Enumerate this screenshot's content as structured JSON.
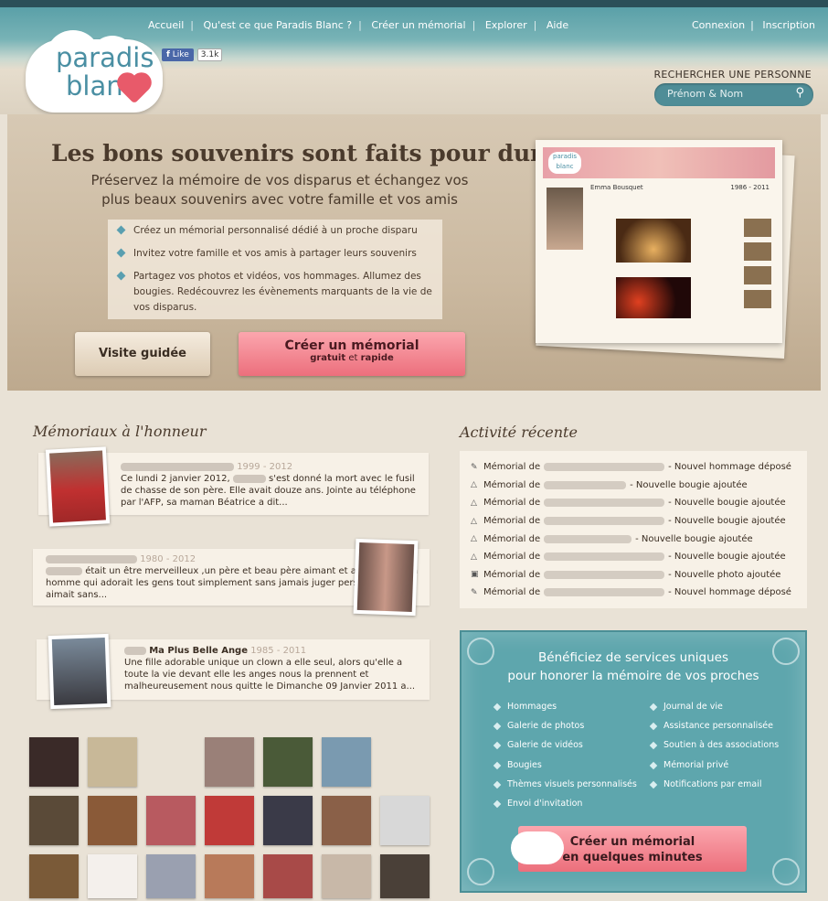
{
  "nav": {
    "items": [
      "Accueil",
      "Qu'est ce que Paradis Blanc ?",
      "Créer un mémorial",
      "Explorer",
      "Aide"
    ],
    "login": "Connexion",
    "signup": "Inscription"
  },
  "logo": {
    "line1": "paradis",
    "line2": "blanc"
  },
  "facebook": {
    "like": "Like",
    "count": "3.1k"
  },
  "search": {
    "label": "RECHERCHER UNE PERSONNE",
    "placeholder": "Prénom & Nom"
  },
  "hero": {
    "title": "Les bons souvenirs sont faits pour durer",
    "subtitle": "Préservez la mémoire de vos disparus et échangez vos plus beaux souvenirs avec votre famille et vos amis",
    "bullets": [
      "Créez un mémorial personnalisé dédié à un proche disparu",
      "Invitez votre famille et vos amis à partager leurs souvenirs",
      "Partagez vos photos et vidéos, vos hommages. Allumez des bougies. Redécouvrez les évènements marquants de la vie de vos disparus."
    ],
    "visit_btn": "Visite guidée",
    "create_btn": "Créer un mémorial",
    "create_sub1": "gratuit",
    "create_sub2": "et",
    "create_sub3": "rapide",
    "preview_name": "Emma Bousquet",
    "preview_years": "1986 - 2011",
    "preview_logo": "paradis blanc"
  },
  "honor": {
    "title": "Mémoriaux à l'honneur",
    "items": [
      {
        "years": "1999 - 2012",
        "text_a": "Ce lundi 2 janvier 2012,",
        "text_b": "s'est donné la mort avec le fusil de chasse de son père. Elle avait douze ans. Jointe au téléphone par l'AFP, sa maman Béatrice a dit..."
      },
      {
        "years": "1980 - 2012",
        "text_a": "était un être merveilleux ,un père et beau père aimant et affectueux. Un homme qui adorait les gens tout simplement sans jamais juger personne il aimait sans..."
      },
      {
        "name": "Ma Plus Belle Ange",
        "years": "1985 - 2011",
        "text_a": "Une fille adorable unique un clown a elle seul, alors qu'elle a toute la vie devant elle les anges nous la prennent et malheureusement nous quitte le Dimanche 09 Janvier 2011 a..."
      }
    ]
  },
  "activity": {
    "title": "Activité récente",
    "prefix": "Mémorial de",
    "rows": [
      {
        "icon": "pen",
        "text": "- Nouvel hommage déposé"
      },
      {
        "icon": "candle",
        "text": "- Nouvelle bougie ajoutée"
      },
      {
        "icon": "candle",
        "text": "- Nouvelle bougie ajoutée"
      },
      {
        "icon": "candle",
        "text": "- Nouvelle bougie ajoutée"
      },
      {
        "icon": "candle",
        "text": "- Nouvelle bougie ajoutée"
      },
      {
        "icon": "candle",
        "text": "- Nouvelle bougie ajoutée"
      },
      {
        "icon": "camera",
        "text": "- Nouvelle photo ajoutée"
      },
      {
        "icon": "pen",
        "text": "- Nouvel hommage déposé"
      }
    ]
  },
  "promo": {
    "title1": "Bénéficiez de services uniques",
    "title2": "pour honorer la mémoire de vos proches",
    "col1": [
      "Hommages",
      "Galerie de photos",
      "Galerie de vidéos",
      "Bougies",
      "Thèmes visuels personnalisés",
      "Envoi d'invitation"
    ],
    "col2": [
      "Journal de vie",
      "Assistance personnalisée",
      "Soutien à des associations",
      "Mémorial privé",
      "Notifications par email"
    ],
    "btn1": "Créer un mémorial",
    "btn2": "en quelques minutes"
  }
}
